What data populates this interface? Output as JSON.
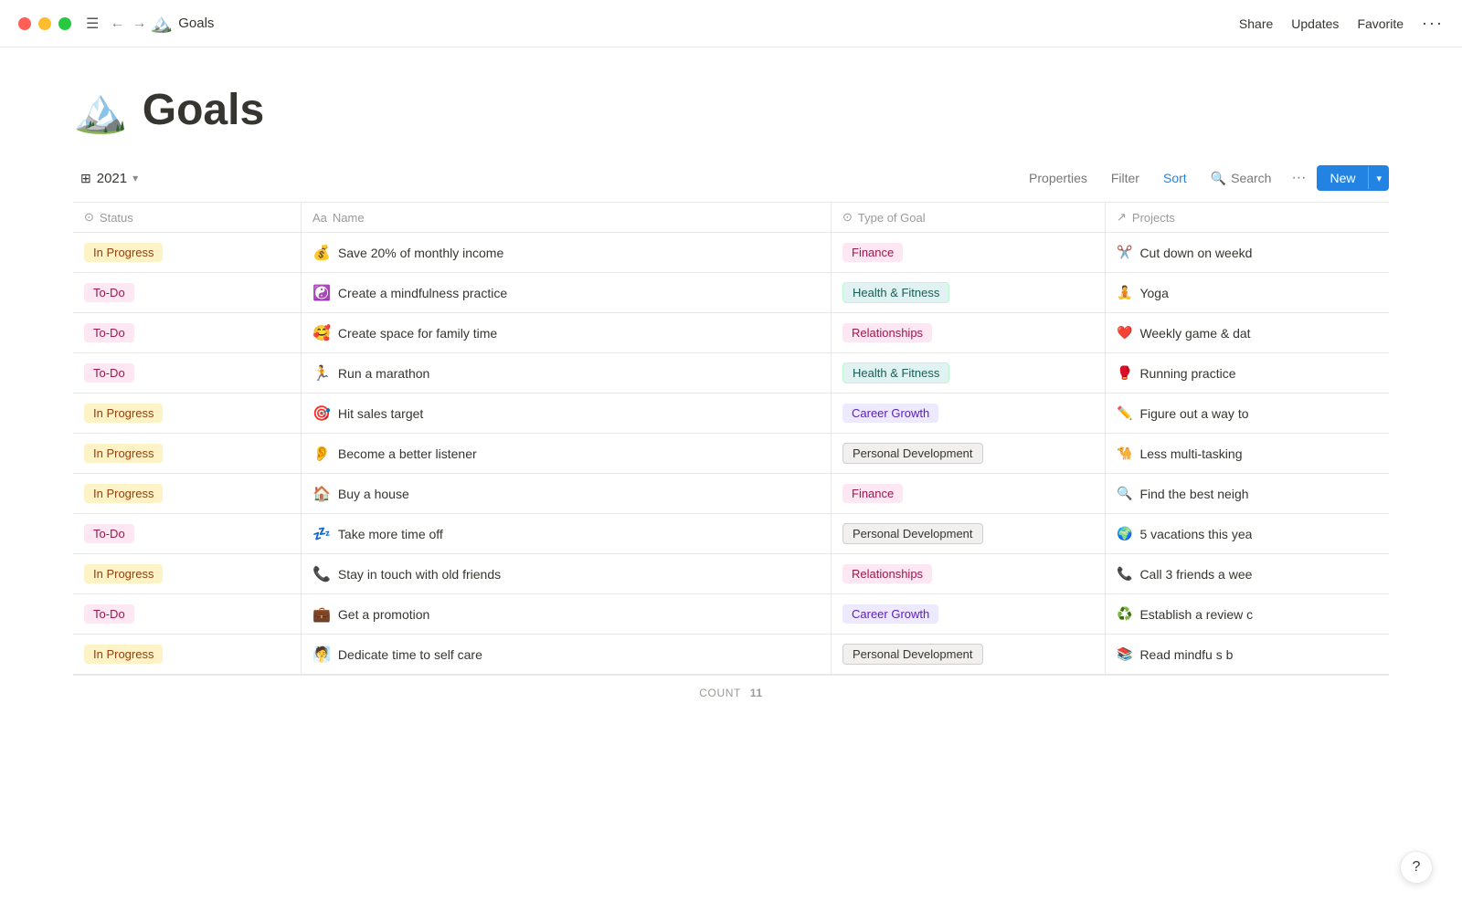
{
  "titlebar": {
    "app_icon": "🏔️",
    "app_title": "Goals",
    "share": "Share",
    "updates": "Updates",
    "favorite": "Favorite",
    "more": "···"
  },
  "toolbar": {
    "view_icon": "⊞",
    "view_label": "2021",
    "properties": "Properties",
    "filter": "Filter",
    "sort": "Sort",
    "search": "Search",
    "more": "···",
    "new": "New"
  },
  "columns": [
    {
      "icon": "⊙",
      "label": "Status"
    },
    {
      "icon": "Aa",
      "label": "Name"
    },
    {
      "icon": "⊙",
      "label": "Type of Goal"
    },
    {
      "icon": "↗",
      "label": "Projects"
    }
  ],
  "rows": [
    {
      "status": "In Progress",
      "status_type": "in-progress",
      "name_emoji": "💰",
      "name": "Save 20% of monthly income",
      "goal_type": "Finance",
      "goal_badge": "finance",
      "project_emoji": "✂️",
      "project": "Cut down on weekd"
    },
    {
      "status": "To-Do",
      "status_type": "to-do",
      "name_emoji": "☯️",
      "name": "Create a mindfulness practice",
      "goal_type": "Health & Fitness",
      "goal_badge": "health",
      "project_emoji": "🧘",
      "project": "Yoga"
    },
    {
      "status": "To-Do",
      "status_type": "to-do",
      "name_emoji": "🥰",
      "name": "Create space for family time",
      "goal_type": "Relationships",
      "goal_badge": "relationships",
      "project_emoji": "❤️",
      "project": "Weekly game & dat"
    },
    {
      "status": "To-Do",
      "status_type": "to-do",
      "name_emoji": "🏃",
      "name": "Run a marathon",
      "goal_type": "Health & Fitness",
      "goal_badge": "health",
      "project_emoji": "🥊",
      "project": "Running practice"
    },
    {
      "status": "In Progress",
      "status_type": "in-progress",
      "name_emoji": "🎯",
      "name": "Hit sales target",
      "goal_type": "Career Growth",
      "goal_badge": "career",
      "project_emoji": "✏️",
      "project": "Figure out a way to"
    },
    {
      "status": "In Progress",
      "status_type": "in-progress",
      "name_emoji": "👂",
      "name": "Become a better listener",
      "goal_type": "Personal Development",
      "goal_badge": "personal",
      "project_emoji": "🐪",
      "project": "Less multi-tasking"
    },
    {
      "status": "In Progress",
      "status_type": "in-progress",
      "name_emoji": "🏠",
      "name": "Buy a house",
      "goal_type": "Finance",
      "goal_badge": "finance",
      "project_emoji": "🔍",
      "project": "Find the best neigh"
    },
    {
      "status": "To-Do",
      "status_type": "to-do",
      "name_emoji": "💤",
      "name": "Take more time off",
      "goal_type": "Personal Development",
      "goal_badge": "personal",
      "project_emoji": "🌍",
      "project": "5 vacations this yea"
    },
    {
      "status": "In Progress",
      "status_type": "in-progress",
      "name_emoji": "📞",
      "name": "Stay in touch with old friends",
      "goal_type": "Relationships",
      "goal_badge": "relationships",
      "project_emoji": "📞",
      "project": "Call 3 friends a wee"
    },
    {
      "status": "To-Do",
      "status_type": "to-do",
      "name_emoji": "💼",
      "name": "Get a promotion",
      "goal_type": "Career Growth",
      "goal_badge": "career",
      "project_emoji": "♻️",
      "project": "Establish a review c"
    },
    {
      "status": "In Progress",
      "status_type": "in-progress",
      "name_emoji": "🧖",
      "name": "Dedicate time to self care",
      "goal_type": "Personal Development",
      "goal_badge": "personal",
      "project_emoji": "📚",
      "project": "Read mindfu  s b"
    }
  ],
  "footer": {
    "count_label": "COUNT",
    "count_value": "11"
  },
  "help": "?"
}
